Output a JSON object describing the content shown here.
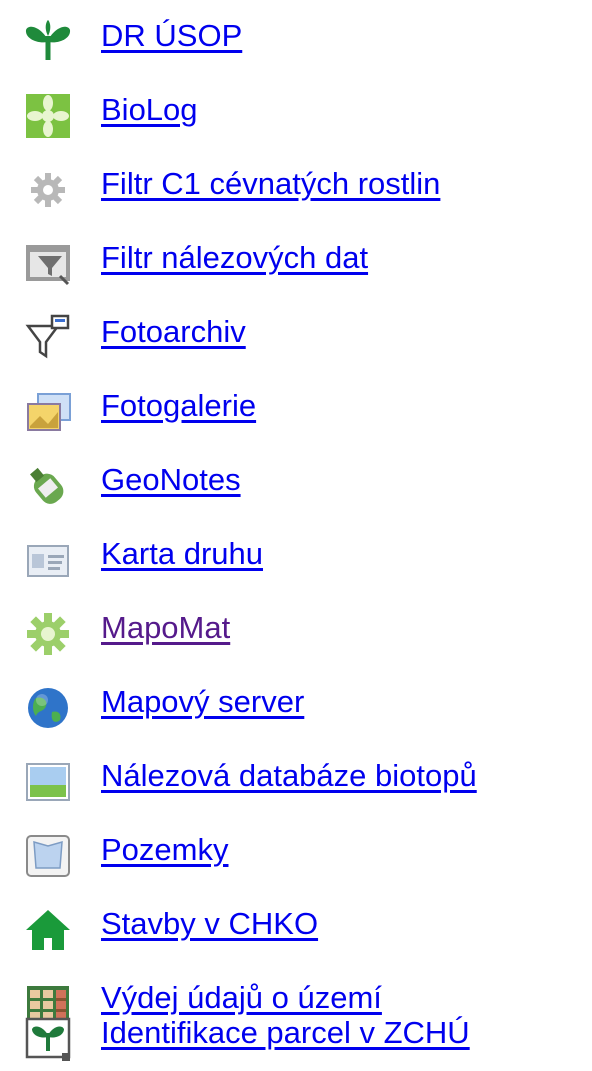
{
  "links": [
    {
      "label": "DR ÚSOP",
      "icon": "sprout-icon",
      "visited": false
    },
    {
      "label": "BioLog",
      "icon": "flower-icon",
      "visited": false
    },
    {
      "label": "Filtr C1 cévnatých rostlin",
      "icon": "gear-icon",
      "visited": false
    },
    {
      "label": "Filtr nálezových dat",
      "icon": "filter-window-icon",
      "visited": false
    },
    {
      "label": "Fotoarchiv",
      "icon": "funnel-icon",
      "visited": false
    },
    {
      "label": "Fotogalerie",
      "icon": "photos-icon",
      "visited": false
    },
    {
      "label": "GeoNotes",
      "icon": "note-bottle-icon",
      "visited": false
    },
    {
      "label": "Karta druhu",
      "icon": "id-card-icon",
      "visited": false
    },
    {
      "label": "MapoMat",
      "icon": "green-gear-icon",
      "visited": true
    },
    {
      "label": "Mapový server",
      "icon": "globe-icon",
      "visited": false
    },
    {
      "label": "Nálezová databáze biotopů",
      "icon": "landscape-icon",
      "visited": false
    },
    {
      "label": "Pozemky",
      "icon": "parcel-icon",
      "visited": false
    },
    {
      "label": "Stavby v CHKO",
      "icon": "house-icon",
      "visited": false
    },
    {
      "label": "Výdej údajů o území",
      "icon": "table-icon",
      "visited": false
    },
    {
      "label": "Identifikace parcel v ZCHÚ",
      "icon": "parcel-sprout-icon",
      "visited": false
    }
  ],
  "colors": {
    "link": "#0000ee",
    "visited": "#551a8b"
  }
}
